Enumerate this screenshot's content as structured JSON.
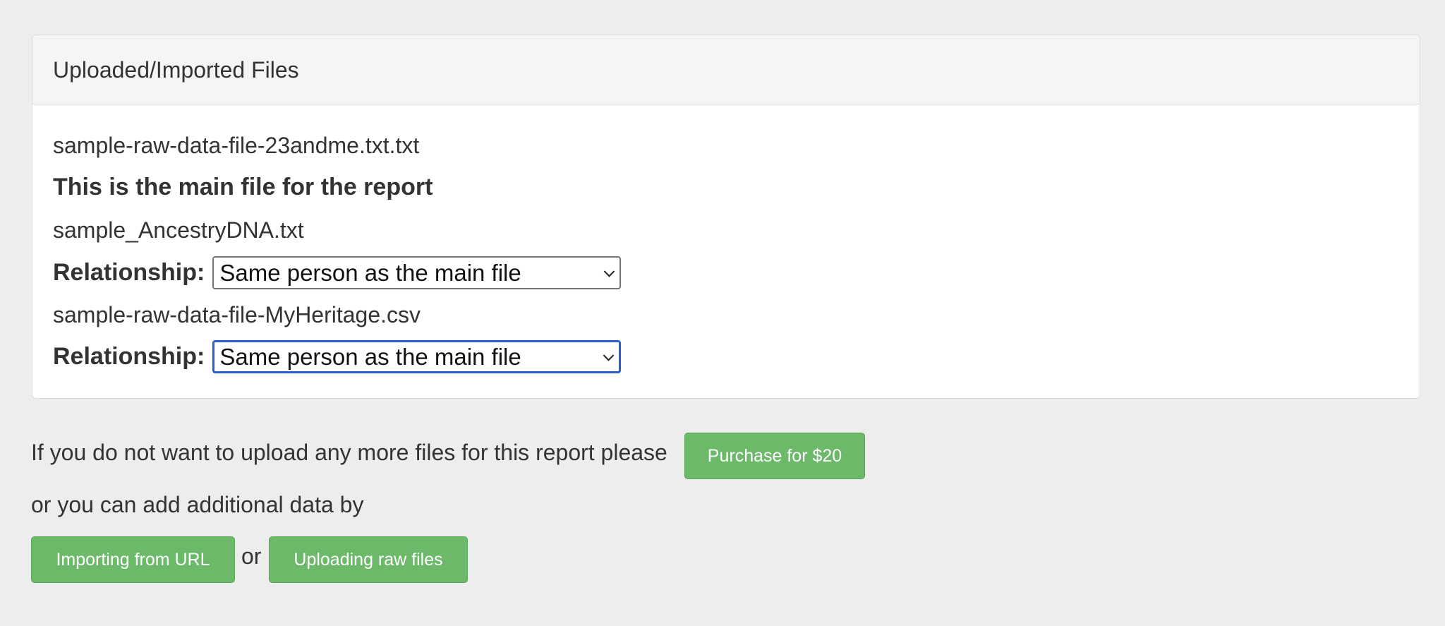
{
  "panel": {
    "title": "Uploaded/Imported Files",
    "main_file": {
      "name": "sample-raw-data-file-23andme.txt.txt",
      "note": "This is the main file for the report"
    },
    "files": [
      {
        "name": "sample_AncestryDNA.txt",
        "relationship_label": "Relationship:",
        "relationship_value": "Same person as the main file"
      },
      {
        "name": "sample-raw-data-file-MyHeritage.csv",
        "relationship_label": "Relationship:",
        "relationship_value": "Same person as the main file"
      }
    ]
  },
  "footer": {
    "purchase_prompt": "If you do not want to upload any more files for this report please",
    "purchase_button": "Purchase for $20",
    "additional_prompt": "or you can add additional data by",
    "import_button": "Importing from URL",
    "or_text": "or",
    "upload_button": "Uploading raw files"
  },
  "colors": {
    "button_green": "#6cb96a",
    "focus_blue": "#2b5fce",
    "page_background": "#ededed"
  }
}
